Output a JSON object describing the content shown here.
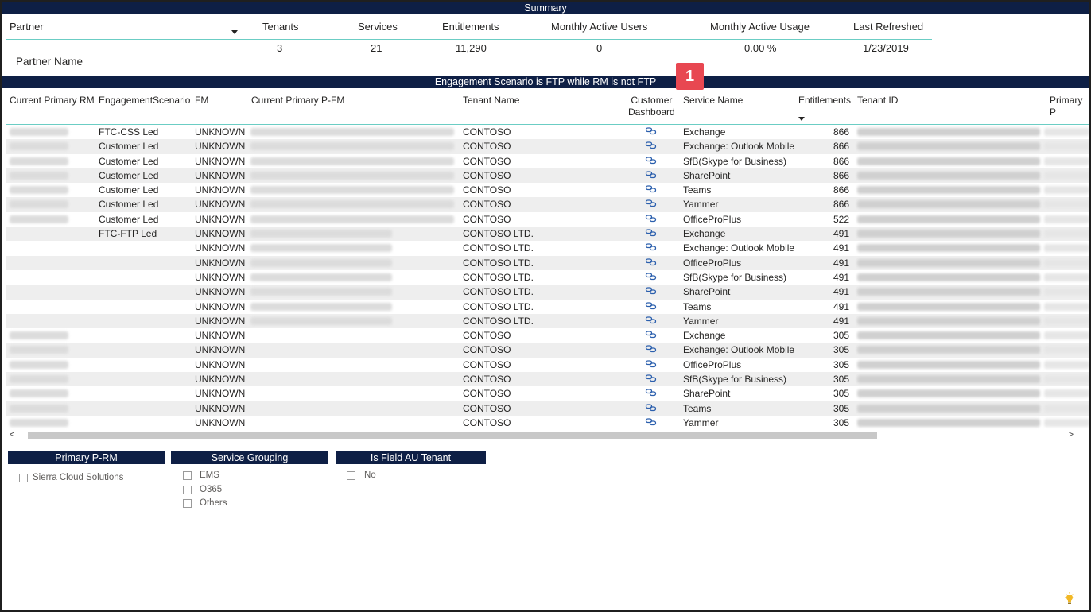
{
  "summary": {
    "title": "Summary",
    "headers": {
      "partner": "Partner",
      "tenants": "Tenants",
      "services": "Services",
      "entitlements": "Entitlements",
      "mau": "Monthly Active Users",
      "mau_usage": "Monthly Active Usage",
      "refreshed": "Last Refreshed"
    },
    "values": {
      "tenants": "3",
      "services": "21",
      "entitlements": "11,290",
      "mau": "0",
      "mau_usage": "0.00 %",
      "refreshed": "1/23/2019"
    },
    "partner_name": "Partner Name"
  },
  "badge": "1",
  "engagement_title": "Engagement Scenario is FTP while RM is not FTP",
  "table": {
    "columns": {
      "rm": "Current Primary RM",
      "eng": "EngagementScenario",
      "fm": "FM",
      "pfm": "Current Primary P-FM",
      "tenant": "Tenant Name",
      "dash1": "Customer",
      "dash2": "Dashboard",
      "service": "Service Name",
      "ent": "Entitlements",
      "tid": "Tenant ID",
      "ppr": "Primary P"
    },
    "rows": [
      {
        "eng": "FTC-CSS Led",
        "fm": "UNKNOWN",
        "tenant": "CONTOSO",
        "service": "Exchange",
        "ent": "866"
      },
      {
        "eng": "Customer Led",
        "fm": "UNKNOWN",
        "tenant": "CONTOSO",
        "service": "Exchange: Outlook Mobile",
        "ent": "866"
      },
      {
        "eng": "Customer Led",
        "fm": "UNKNOWN",
        "tenant": "CONTOSO",
        "service": "SfB(Skype for Business)",
        "ent": "866"
      },
      {
        "eng": "Customer Led",
        "fm": "UNKNOWN",
        "tenant": "CONTOSO",
        "service": "SharePoint",
        "ent": "866"
      },
      {
        "eng": "Customer Led",
        "fm": "UNKNOWN",
        "tenant": "CONTOSO",
        "service": "Teams",
        "ent": "866"
      },
      {
        "eng": "Customer Led",
        "fm": "UNKNOWN",
        "tenant": "CONTOSO",
        "service": "Yammer",
        "ent": "866"
      },
      {
        "eng": "Customer Led",
        "fm": "UNKNOWN",
        "tenant": "CONTOSO",
        "service": "OfficeProPlus",
        "ent": "522"
      },
      {
        "eng": "FTC-FTP Led",
        "fm": "UNKNOWN",
        "tenant": "CONTOSO LTD.",
        "service": "Exchange",
        "ent": "491"
      },
      {
        "eng": "",
        "fm": "UNKNOWN",
        "tenant": "CONTOSO LTD.",
        "service": "Exchange: Outlook Mobile",
        "ent": "491"
      },
      {
        "eng": "",
        "fm": "UNKNOWN",
        "tenant": "CONTOSO LTD.",
        "service": "OfficeProPlus",
        "ent": "491"
      },
      {
        "eng": "",
        "fm": "UNKNOWN",
        "tenant": "CONTOSO LTD.",
        "service": "SfB(Skype for Business)",
        "ent": "491"
      },
      {
        "eng": "",
        "fm": "UNKNOWN",
        "tenant": "CONTOSO LTD.",
        "service": "SharePoint",
        "ent": "491"
      },
      {
        "eng": "",
        "fm": "UNKNOWN",
        "tenant": "CONTOSO LTD.",
        "service": "Teams",
        "ent": "491"
      },
      {
        "eng": "",
        "fm": "UNKNOWN",
        "tenant": "CONTOSO LTD.",
        "service": "Yammer",
        "ent": "491"
      },
      {
        "eng": "",
        "fm": "UNKNOWN",
        "tenant": "CONTOSO",
        "service": "Exchange",
        "ent": "305"
      },
      {
        "eng": "",
        "fm": "UNKNOWN",
        "tenant": "CONTOSO",
        "service": "Exchange: Outlook Mobile",
        "ent": "305"
      },
      {
        "eng": "",
        "fm": "UNKNOWN",
        "tenant": "CONTOSO",
        "service": "OfficeProPlus",
        "ent": "305"
      },
      {
        "eng": "",
        "fm": "UNKNOWN",
        "tenant": "CONTOSO",
        "service": "SfB(Skype for Business)",
        "ent": "305"
      },
      {
        "eng": "",
        "fm": "UNKNOWN",
        "tenant": "CONTOSO",
        "service": "SharePoint",
        "ent": "305"
      },
      {
        "eng": "",
        "fm": "UNKNOWN",
        "tenant": "CONTOSO",
        "service": "Teams",
        "ent": "305"
      },
      {
        "eng": "",
        "fm": "UNKNOWN",
        "tenant": "CONTOSO",
        "service": "Yammer",
        "ent": "305"
      }
    ]
  },
  "scroll": {
    "left": "<",
    "right": ">"
  },
  "slicers": {
    "primary_prm": {
      "title": "Primary P-RM",
      "items": [
        "Sierra Cloud Solutions"
      ]
    },
    "service_grouping": {
      "title": "Service Grouping",
      "items": [
        "EMS",
        "O365",
        "Others"
      ]
    },
    "field_au": {
      "title": "Is Field AU Tenant",
      "items": [
        "No"
      ]
    }
  },
  "colors": {
    "header_bar": "#0e1f45",
    "accent_line": "#6bcdc4",
    "badge": "#e84751",
    "link_icon": "#2b5fad"
  }
}
